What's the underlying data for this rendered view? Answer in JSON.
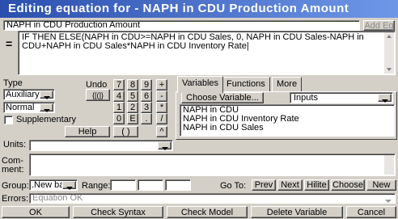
{
  "window": {
    "title": "Editing equation for - NAPH in CDU Production Amount"
  },
  "variable_name": {
    "value": "NAPH in CDU Production Amount",
    "add_eq_label": "Add Eq"
  },
  "equation": {
    "prefix": "=",
    "line1": "IF THEN ELSE(NAPH in CDU>=NAPH in CDU Sales, 0, NAPH in CDU Sales-NAPH in",
    "line2": "CDU+NAPH in CDU Sales*NAPH in CDU Inventory Rate"
  },
  "type": {
    "label": "Type",
    "value": "Auxiliary",
    "subtype": "Normal",
    "supplementary_label": "Supplementary"
  },
  "keypad": {
    "undo": "Undo",
    "braces": "{[(]}",
    "k7": "7",
    "k8": "8",
    "k9": "9",
    "plus": "+",
    "k4": "4",
    "k5": "5",
    "k6": "6",
    "minus": "-",
    "k1": "1",
    "k2": "2",
    "k3": "3",
    "times": "*",
    "k0": "0",
    "e": "E",
    "dot": ".",
    "div": "/",
    "parens": "( )",
    "caret": "^",
    "help": "Help"
  },
  "tabs": {
    "variables": "Variables",
    "functions": "Functions",
    "more": "More"
  },
  "choose_variable": {
    "label": "Choose Variable...",
    "filter": "Inputs"
  },
  "inputs_list": [
    "NAPH in CDU",
    "NAPH in CDU Inventory Rate",
    "NAPH in CDU Sales"
  ],
  "units": {
    "label": "Units:",
    "value": ""
  },
  "comment": {
    "label1": "Com-",
    "label2": "ment:",
    "value": ""
  },
  "group": {
    "label": "Group:",
    "value": ".New bau",
    "range_label": "Range:",
    "goto_label": "Go To:"
  },
  "nav": {
    "prev": "Prev",
    "next": "Next",
    "hilite": "Hilite",
    "choose": "Choose",
    "new": "New"
  },
  "errors": {
    "label": "Errors:",
    "value": "Equation OK"
  },
  "footer": {
    "ok": "OK",
    "check_syntax": "Check Syntax",
    "check_model": "Check Model",
    "delete_variable": "Delete Variable",
    "cancel": "Cancel"
  }
}
